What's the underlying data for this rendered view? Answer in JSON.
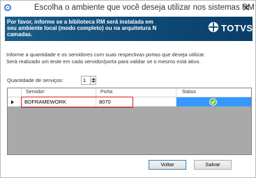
{
  "window": {
    "title": "Escolha o ambiente que você deseja utilizar nos sistemas RM",
    "close_glyph": "✕"
  },
  "banner": {
    "message": "Por favor, informe se a biblioteca RM será instalada em seu ambiente local (modo completo) ou na arquitetura N camadas.",
    "logo_text": "TOTVS",
    "background_color": "#0f4a78"
  },
  "info": {
    "line1": "Informe a quantidade e os servidores com suas respectivas portas que deseja utilizar.",
    "line2": "Será realizado um teste em cada servidor/porta para validar se o mesmo está ativo."
  },
  "quantity": {
    "label": "Quantidade de serviços:",
    "value": "1"
  },
  "grid": {
    "columns": [
      "Servidor:",
      "Porta:",
      "Status"
    ],
    "rows": [
      {
        "servidor": "BDFRAMEWORK",
        "porta": "8070",
        "status_icon": "check-circle-icon"
      }
    ],
    "status_color": "#3399ff",
    "highlight_color": "#d01818"
  },
  "buttons": {
    "back": "Voltar",
    "save": "Salvar"
  }
}
